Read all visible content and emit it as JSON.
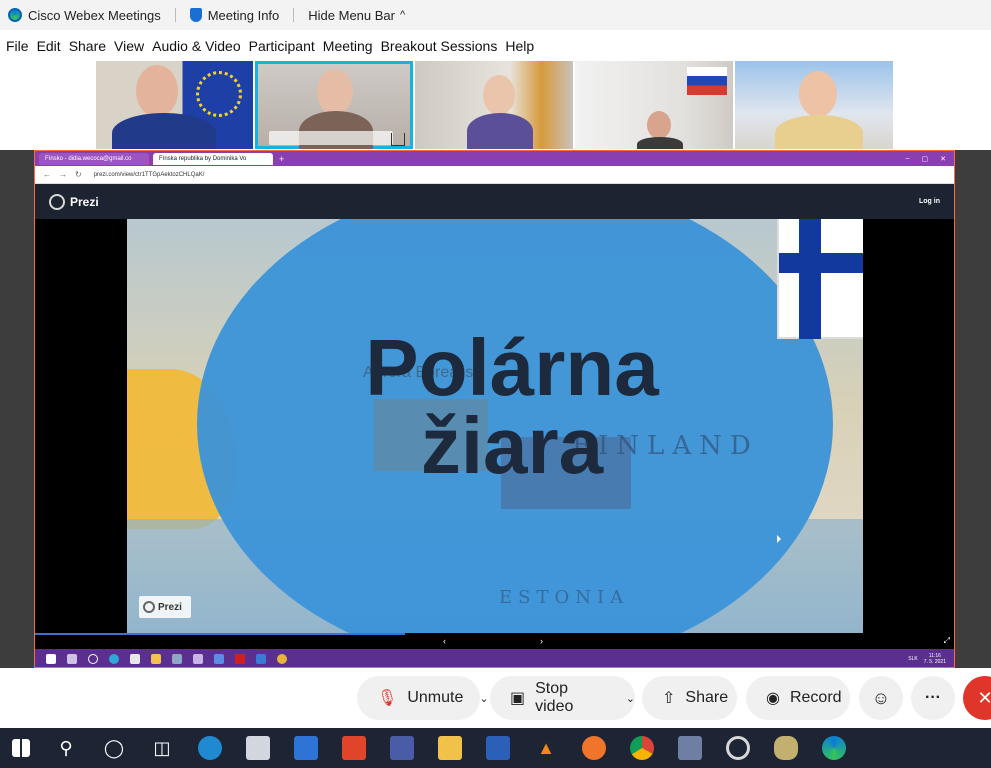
{
  "titlebar": {
    "app_title": "Cisco Webex Meetings",
    "meeting_info": "Meeting Info",
    "hide_menu": "Hide Menu Bar",
    "chevron": "^"
  },
  "menu": {
    "items": [
      "File",
      "Edit",
      "Share",
      "View",
      "Audio & Video",
      "Participant",
      "Meeting",
      "Breakout Sessions",
      "Help"
    ]
  },
  "browser": {
    "tabs": [
      {
        "label": "Fínsko - didia.wecoca@gmail.co"
      },
      {
        "label": "Fínska republika by Dominika Vo"
      }
    ],
    "tab_plus": "+",
    "win_controls": [
      "–",
      "▢",
      "✕"
    ],
    "nav_buttons": [
      "←",
      "→",
      "↻"
    ],
    "url": "prezi.com/view/ctr1TTGpAektozCHLQaK/"
  },
  "prezi": {
    "brand": "Prezi",
    "login": "Log in",
    "slide_title_line1": "Polárna",
    "slide_title_line2": "žiara",
    "ghost_text_1": "Aurora Borealis",
    "ghost_text_2": "FINLAND",
    "ghost_text_3": "ESTONIA",
    "badge": "Prezi",
    "nav_prev": "‹",
    "nav_next": "›",
    "nav_fullscreen": "⤢"
  },
  "inner_taskbar": {
    "clock_time": "11:16",
    "clock_date": "7. 5. 2021",
    "lang": "SLK"
  },
  "controls": {
    "unmute": "Unmute",
    "stop_video": "Stop video",
    "share": "Share",
    "record": "Record",
    "more": "···",
    "dropdown": "⌄",
    "leave": "✕"
  },
  "colors": {
    "accent_active_tile": "#13b4e0",
    "leave_red": "#e0352b",
    "prezi_bubble": "#3b94d8",
    "browser_frame": "#ff6a3d",
    "taskbar_bg": "#1d2535"
  },
  "icons": {
    "webex": "webex-logo-icon",
    "shield": "shield-icon",
    "mic_muted": "mic-muted-icon",
    "camera": "camera-icon",
    "share": "share-icon",
    "record": "record-icon",
    "reactions": "smiley-icon"
  }
}
